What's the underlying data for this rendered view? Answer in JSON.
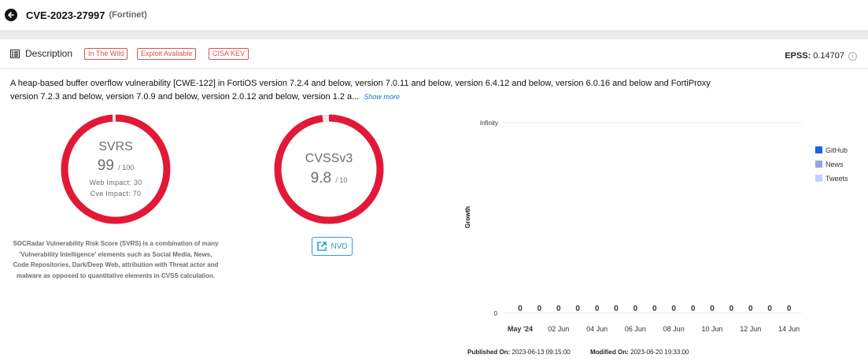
{
  "header": {
    "cve_id": "CVE-2023-27997",
    "vendor": "(Fortinet)"
  },
  "description": {
    "label": "Description",
    "tags": [
      "In The Wild",
      "Exploit Avaliable",
      "CISA KEV"
    ],
    "epss_label": "EPSS:",
    "epss_value": "0.14707",
    "text": "A heap-based buffer overflow vulnerability [CWE-122] in FortiOS version 7.2.4 and below, version 7.0.11 and below, version 6.4.12 and below, version 6.0.16 and below and FortiProxy version 7.2.3 and below, version 7.0.9 and below, version 2.0.12 and below, version 1.2 a...",
    "show_more": "Show more"
  },
  "svrs": {
    "title": "SVRS",
    "score": "99",
    "max": "/ 100",
    "score_value": 99,
    "score_max": 100,
    "web_impact": "Web Impact: 30",
    "cve_impact": "Cve Impact: 70",
    "color": "#e31837",
    "explanation": "SOCRadar Vulnerability Risk Score (SVRS) is a combination of many 'Vulnerability Intelligence' elements such as Social Media, News, Code Repositories, Dark/Deep Web, attribution with Threat actor and malware as opposed to quantitative elements in CVSS calculation."
  },
  "cvss": {
    "title": "CVSSv3",
    "score": "9.8",
    "max": "/ 10",
    "score_value": 9.8,
    "score_max": 10,
    "color": "#e31837",
    "nvd_label": "NVD"
  },
  "chart_data": {
    "type": "bar",
    "categories": [
      "May '24",
      "",
      "02 Jun",
      "",
      "04 Jun",
      "",
      "06 Jun",
      "",
      "08 Jun",
      "",
      "10 Jun",
      "",
      "12 Jun",
      "",
      "14 Jun"
    ],
    "tick_labels": [
      "May '24",
      "02 Jun",
      "04 Jun",
      "06 Jun",
      "08 Jun",
      "10 Jun",
      "12 Jun",
      "14 Jun"
    ],
    "series": [
      {
        "name": "GitHub",
        "color": "#1a66e0",
        "values": [
          0,
          0,
          0,
          0,
          0,
          0,
          0,
          0,
          0,
          0,
          0,
          0,
          0,
          0,
          0
        ]
      },
      {
        "name": "News",
        "color": "#8fa8df",
        "values": [
          0,
          0,
          0,
          0,
          0,
          0,
          0,
          0,
          0,
          0,
          0,
          0,
          0,
          0,
          0
        ]
      },
      {
        "name": "Tweets",
        "color": "#c4d1f0",
        "values": [
          0,
          0,
          0,
          0,
          0,
          0,
          0,
          0,
          0,
          0,
          0,
          0,
          0,
          0,
          0
        ]
      }
    ],
    "data_labels": [
      "0",
      "0",
      "0",
      "0",
      "0",
      "0",
      "0",
      "0",
      "0",
      "0",
      "0",
      "0",
      "0",
      "0",
      "0"
    ],
    "ylabel": "Growth",
    "y_ticks": [
      "Infinity",
      "0"
    ],
    "legend": "right",
    "grid": true
  },
  "footer": {
    "published_label": "Published On:",
    "published_value": "2023-06-13 09:15:00",
    "modified_label": "Modified On:",
    "modified_value": "2023-06-20 19:33:00"
  }
}
